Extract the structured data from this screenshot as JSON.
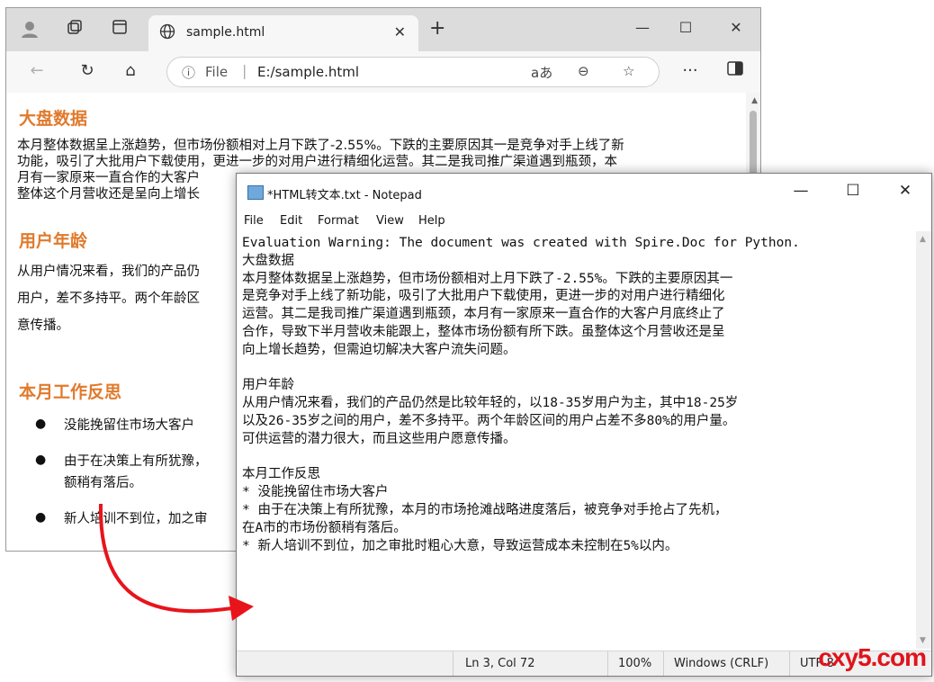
{
  "browser": {
    "tab_title": "sample.html",
    "address": {
      "scheme": "File",
      "url": "E:/sample.html"
    },
    "page": {
      "h1": "大盘数据",
      "p1_lines": [
        "本月整体数据呈上涨趋势，但市场份额相对上月下跌了-2.55%。下跌的主要原因其一是竞争对手上线了新",
        "功能，吸引了大批用户下载使用，更进一步的对用户进行精细化运营。其二是我司推广渠道遇到瓶颈，本",
        "月有一家原来一直合作的大客户",
        "整体这个月营收还是呈向上增长"
      ],
      "h2": "用户年龄",
      "p2_lines": [
        "从用户情况来看，我们的产品仍",
        "用户，差不多持平。两个年龄区",
        "意传播。"
      ],
      "h3": "本月工作反思",
      "list": [
        "没能挽留住市场大客户",
        "由于在决策上有所犹豫，",
        "新人培训不到位，加之审"
      ],
      "list_cont": "额稍有落后。"
    }
  },
  "notepad": {
    "title": "*HTML转文本.txt - Notepad",
    "menu": [
      "File",
      "Edit",
      "Format",
      "View",
      "Help"
    ],
    "text": "Evaluation Warning: The document was created with Spire.Doc for Python.\n大盘数据\n本月整体数据呈上涨趋势，但市场份额相对上月下跌了-2.55%。下跌的主要原因其一\n是竞争对手上线了新功能，吸引了大批用户下载使用，更进一步的对用户进行精细化\n运营。其二是我司推广渠道遇到瓶颈，本月有一家原来一直合作的大客户月底终止了\n合作，导致下半月营收未能跟上，整体市场份额有所下跌。虽整体这个月营收还是呈\n向上增长趋势，但需迫切解决大客户流失问题。\n\n用户年龄\n从用户情况来看，我们的产品仍然是比较年轻的，以18-35岁用户为主，其中18-25岁\n以及26-35岁之间的用户，差不多持平。两个年龄区间的用户占差不多80%的用户量。\n可供运营的潜力很大，而且这些用户愿意传播。\n\n本月工作反思\n* 没能挽留住市场大客户\n* 由于在决策上有所犹豫，本月的市场抢滩战略进度落后，被竞争对手抢占了先机，\n在A市的市场份额稍有落后。\n* 新人培训不到位，加之审批时粗心大意，导致运营成本未控制在5%以内。",
    "status": {
      "position": "Ln 3, Col 72",
      "zoom": "100%",
      "line_ending": "Windows (CRLF)",
      "encoding": "UTF-8"
    }
  },
  "watermark": "cxy5.com",
  "colors": {
    "heading": "#e07a2c",
    "arrow": "#e8141c"
  }
}
